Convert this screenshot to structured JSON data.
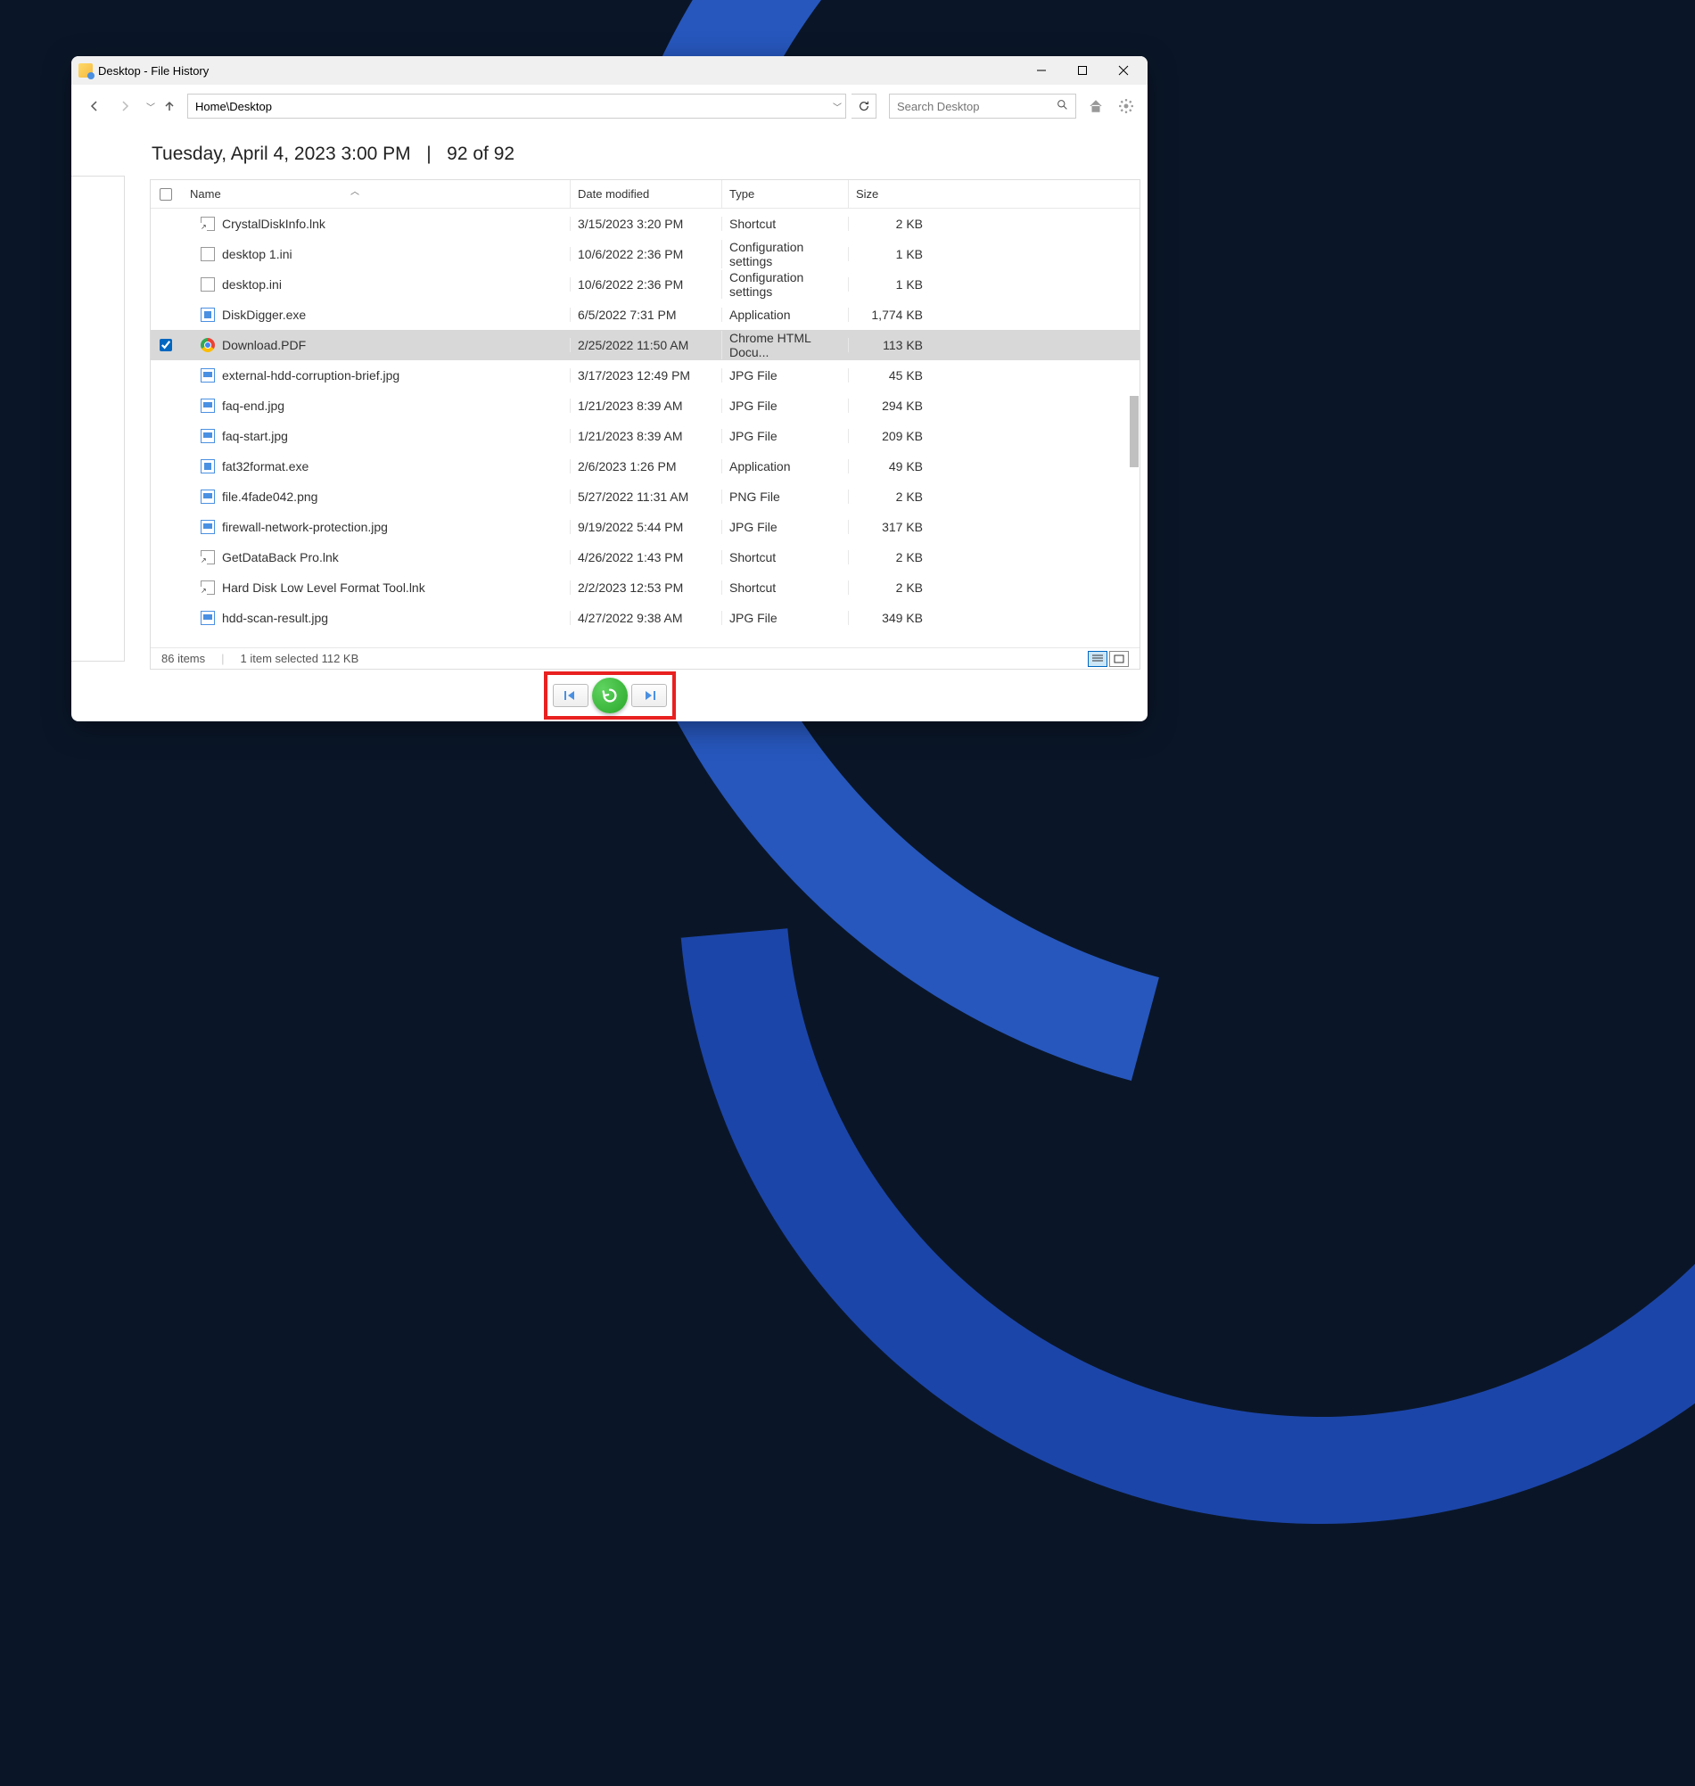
{
  "window": {
    "title": "Desktop - File History"
  },
  "nav": {
    "address": "Home\\Desktop",
    "search_placeholder": "Search Desktop"
  },
  "snapshot": {
    "date_label": "Tuesday, April 4, 2023 3:00 PM",
    "separator": "|",
    "position": "92 of 92"
  },
  "columns": {
    "name": "Name",
    "date": "Date modified",
    "type": "Type",
    "size": "Size"
  },
  "files": [
    {
      "name": "CrystalDiskInfo.lnk",
      "date": "3/15/2023 3:20 PM",
      "type": "Shortcut",
      "size": "2 KB",
      "icon": "shortcut",
      "selected": false
    },
    {
      "name": "desktop 1.ini",
      "date": "10/6/2022 2:36 PM",
      "type": "Configuration settings",
      "size": "1 KB",
      "icon": "ini",
      "selected": false
    },
    {
      "name": "desktop.ini",
      "date": "10/6/2022 2:36 PM",
      "type": "Configuration settings",
      "size": "1 KB",
      "icon": "ini",
      "selected": false
    },
    {
      "name": "DiskDigger.exe",
      "date": "6/5/2022 7:31 PM",
      "type": "Application",
      "size": "1,774 KB",
      "icon": "exe",
      "selected": false
    },
    {
      "name": "Download.PDF",
      "date": "2/25/2022 11:50 AM",
      "type": "Chrome HTML Docu...",
      "size": "113 KB",
      "icon": "chrome",
      "selected": true
    },
    {
      "name": "external-hdd-corruption-brief.jpg",
      "date": "3/17/2023 12:49 PM",
      "type": "JPG File",
      "size": "45 KB",
      "icon": "img",
      "selected": false
    },
    {
      "name": "faq-end.jpg",
      "date": "1/21/2023 8:39 AM",
      "type": "JPG File",
      "size": "294 KB",
      "icon": "img",
      "selected": false
    },
    {
      "name": "faq-start.jpg",
      "date": "1/21/2023 8:39 AM",
      "type": "JPG File",
      "size": "209 KB",
      "icon": "img",
      "selected": false
    },
    {
      "name": "fat32format.exe",
      "date": "2/6/2023 1:26 PM",
      "type": "Application",
      "size": "49 KB",
      "icon": "exe",
      "selected": false
    },
    {
      "name": "file.4fade042.png",
      "date": "5/27/2022 11:31 AM",
      "type": "PNG File",
      "size": "2 KB",
      "icon": "img",
      "selected": false
    },
    {
      "name": "firewall-network-protection.jpg",
      "date": "9/19/2022 5:44 PM",
      "type": "JPG File",
      "size": "317 KB",
      "icon": "img",
      "selected": false
    },
    {
      "name": "GetDataBack Pro.lnk",
      "date": "4/26/2022 1:43 PM",
      "type": "Shortcut",
      "size": "2 KB",
      "icon": "shortcut",
      "selected": false
    },
    {
      "name": "Hard Disk Low Level Format Tool.lnk",
      "date": "2/2/2023 12:53 PM",
      "type": "Shortcut",
      "size": "2 KB",
      "icon": "shortcut",
      "selected": false
    },
    {
      "name": "hdd-scan-result.jpg",
      "date": "4/27/2022 9:38 AM",
      "type": "JPG File",
      "size": "349 KB",
      "icon": "img",
      "selected": false
    }
  ],
  "status": {
    "item_count": "86 items",
    "selection": "1 item selected  112 KB"
  }
}
